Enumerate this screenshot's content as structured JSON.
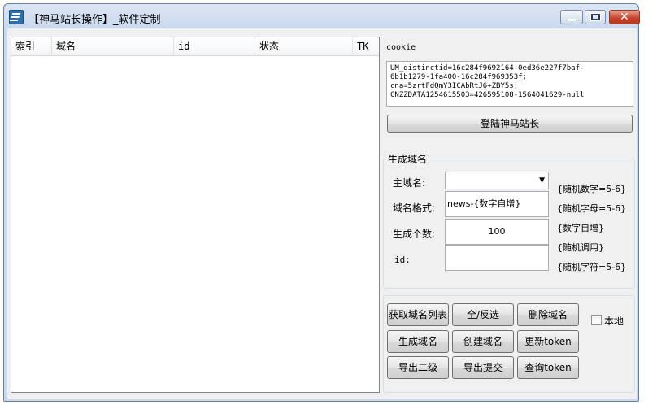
{
  "window": {
    "title": "【神马站长操作】_软件定制",
    "min_label": "minimize",
    "max_label": "maximize",
    "close_glyph": "✕"
  },
  "list": {
    "columns": [
      "索引",
      "域名",
      "id",
      "状态",
      "TK"
    ]
  },
  "cookie": {
    "label": "cookie",
    "lines": [
      "UM_distinctid=16c284f9692164-0ed36e227f7baf-",
      "6b1b1279-1fa400-16c284f969353f;",
      "cna=5zrtFdQmY3ICAbRtJ6+ZBY5s;",
      "CNZZDATA1254615503=426595108-1564041629-null"
    ]
  },
  "login_button": "登陆神马站长",
  "generate": {
    "group_title": "生成域名",
    "main_domain_label": "主域名:",
    "main_domain_value": "",
    "format_label": "域名格式:",
    "format_value": "news-{数字自增}",
    "count_label": "生成个数:",
    "count_value": "100",
    "id_label": "id:",
    "id_value": "",
    "hints": [
      "{随机数字=5-6}",
      "{随机字母=5-6}",
      "{数字自增}",
      "{随机调用}",
      "{随机字符=5-6}"
    ]
  },
  "actions": {
    "get_list": "获取域名列表",
    "select_all": "全/反选",
    "delete_domain": "删除域名",
    "local_checkbox_label": "本地",
    "local_checked": false,
    "gen_domain": "生成域名",
    "create_domain": "创建域名",
    "update_token": "更新token",
    "export_second": "导出二级",
    "export_submit": "导出提交",
    "query_token": "查询token"
  },
  "icons": {
    "app": "app-icon",
    "select_arrow": "chevron-down-icon"
  }
}
